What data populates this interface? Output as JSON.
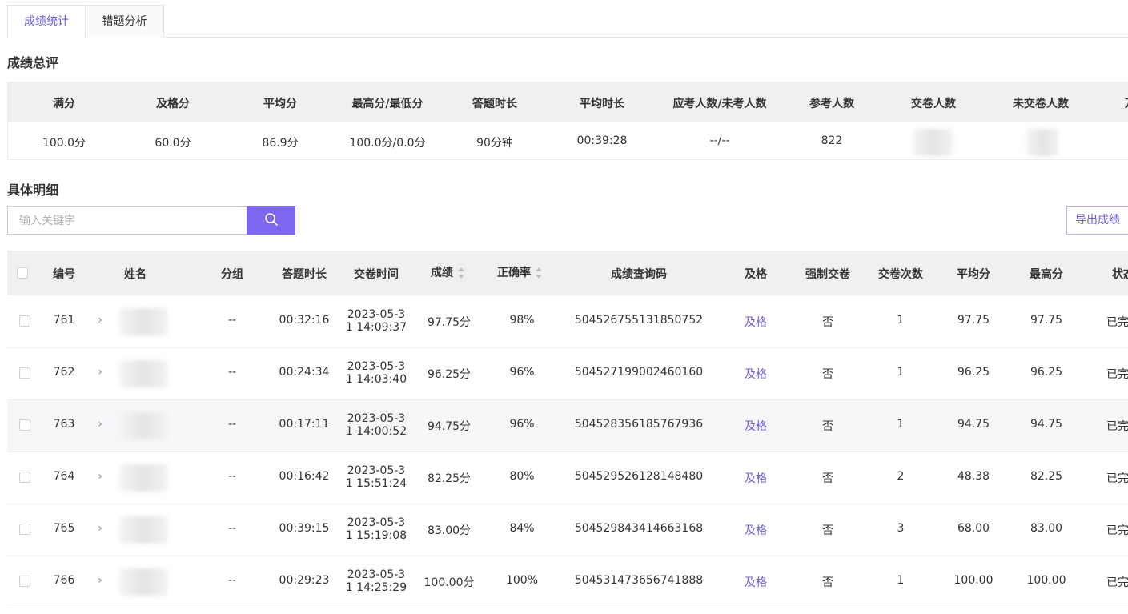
{
  "tabs": [
    {
      "label": "成绩统计",
      "active": true
    },
    {
      "label": "错题分析",
      "active": false
    }
  ],
  "overall_title": "成绩总评",
  "summary": {
    "headers": [
      "满分",
      "及格分",
      "平均分",
      "最高分/最低分",
      "答题时长",
      "平均时长",
      "应考人数/未考人数",
      "参考人数",
      "交卷人数",
      "未交卷人数",
      "万"
    ],
    "values": [
      "100.0分",
      "60.0分",
      "86.9分",
      "100.0分/0.0分",
      "90分钟",
      "00:39:28",
      "--/--",
      "822"
    ]
  },
  "detail_title": "具体明细",
  "search": {
    "placeholder": "输入关键字",
    "icon": "search-icon"
  },
  "export_label": "导出成绩",
  "table": {
    "headers": [
      "编号",
      "姓名",
      "分组",
      "答题时长",
      "交卷时间",
      "成绩",
      "正确率",
      "成绩查询码",
      "及格",
      "强制交卷",
      "交卷次数",
      "平均分",
      "最高分",
      "状态"
    ],
    "rows": [
      {
        "id": "761",
        "group": "--",
        "duration": "00:32:16",
        "time1": "2023-05-3",
        "time2": "1 14:09:37",
        "score": "97.75分",
        "rate": "98%",
        "code": "504526755131850752",
        "pass": "及格",
        "forced": "否",
        "count": "1",
        "avg": "97.75",
        "max": "97.75",
        "status": "已完成"
      },
      {
        "id": "762",
        "group": "--",
        "duration": "00:24:34",
        "time1": "2023-05-3",
        "time2": "1 14:03:40",
        "score": "96.25分",
        "rate": "96%",
        "code": "504527199002460160",
        "pass": "及格",
        "forced": "否",
        "count": "1",
        "avg": "96.25",
        "max": "96.25",
        "status": "已完成"
      },
      {
        "id": "763",
        "group": "--",
        "duration": "00:17:11",
        "time1": "2023-05-3",
        "time2": "1 14:00:52",
        "score": "94.75分",
        "rate": "96%",
        "code": "504528356185767936",
        "pass": "及格",
        "forced": "否",
        "count": "1",
        "avg": "94.75",
        "max": "94.75",
        "status": "已完成"
      },
      {
        "id": "764",
        "group": "--",
        "duration": "00:16:42",
        "time1": "2023-05-3",
        "time2": "1 15:51:24",
        "score": "82.25分",
        "rate": "80%",
        "code": "504529526128148480",
        "pass": "及格",
        "forced": "否",
        "count": "2",
        "avg": "48.38",
        "max": "82.25",
        "status": "已完成"
      },
      {
        "id": "765",
        "group": "--",
        "duration": "00:39:15",
        "time1": "2023-05-3",
        "time2": "1 15:19:08",
        "score": "83.00分",
        "rate": "84%",
        "code": "504529843414663168",
        "pass": "及格",
        "forced": "否",
        "count": "3",
        "avg": "68.00",
        "max": "83.00",
        "status": "已完成"
      },
      {
        "id": "766",
        "group": "--",
        "duration": "00:29:23",
        "time1": "2023-05-3",
        "time2": "1 14:25:29",
        "score": "100.00分",
        "rate": "100%",
        "code": "504531473656741888",
        "pass": "及格",
        "forced": "否",
        "count": "1",
        "avg": "100.00",
        "max": "100.00",
        "status": "已完成"
      }
    ]
  },
  "colors": {
    "accent": "#7b68ee",
    "link": "#6b5fd6"
  }
}
